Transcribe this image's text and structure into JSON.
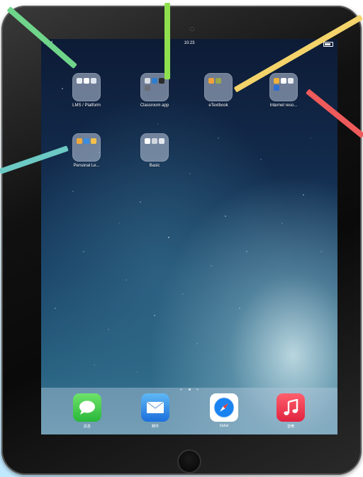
{
  "status_bar": {
    "device": "iPad",
    "time": "10:23"
  },
  "folders": [
    {
      "label": "LMS / Platform"
    },
    {
      "label": "Classroom app"
    },
    {
      "label": "eTextbook"
    },
    {
      "label": "Internet reso..."
    },
    {
      "label": "Personal Le..."
    },
    {
      "label": "Basic"
    }
  ],
  "dock": [
    {
      "label": "訊息",
      "icon": "messages-icon"
    },
    {
      "label": "郵件",
      "icon": "mail-icon"
    },
    {
      "label": "Safari",
      "icon": "safari-icon"
    },
    {
      "label": "音樂",
      "icon": "music-icon"
    }
  ],
  "page_indicator": {
    "pages": 3,
    "current": 2
  },
  "colors": {
    "pointer_green": "#6fd58a",
    "pointer_lime": "#8fe04f",
    "pointer_yellow": "#f3d36a",
    "pointer_red": "#ef5a5a",
    "pointer_teal": "#6cc9c4"
  }
}
